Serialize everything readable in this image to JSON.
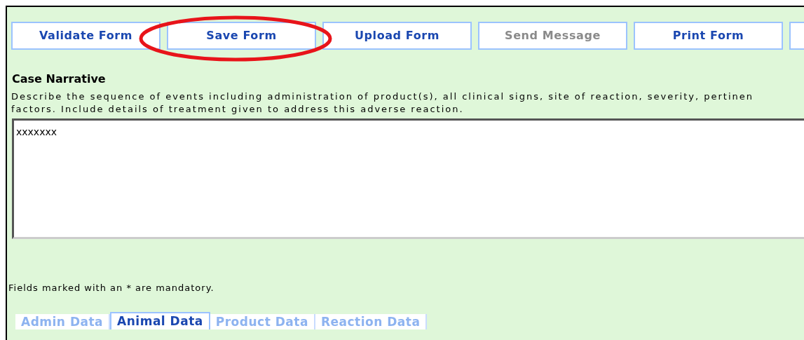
{
  "toolbar": [
    {
      "label": "Validate Form",
      "disabled": false
    },
    {
      "label": "Save Form",
      "disabled": false
    },
    {
      "label": "Upload Form",
      "disabled": false
    },
    {
      "label": "Send Message",
      "disabled": true
    },
    {
      "label": "Print Form",
      "disabled": false
    }
  ],
  "annotation": {
    "kind": "ellipse"
  },
  "case_narrative": {
    "heading": "Case Narrative",
    "description_lines": [
      "Describe the sequence of events including administration of product(s), all clinical signs, site of reaction, severity, pertinen",
      "factors. Include details of treatment given to address this adverse reaction."
    ],
    "value": "xxxxxxx"
  },
  "mandatory_note": "Fields marked with an * are mandatory.",
  "tabs": [
    {
      "label": "Admin Data",
      "selected": false
    },
    {
      "label": "Animal Data",
      "selected": true
    },
    {
      "label": "Product Data",
      "selected": false
    },
    {
      "label": "Reaction Data",
      "selected": false
    }
  ]
}
